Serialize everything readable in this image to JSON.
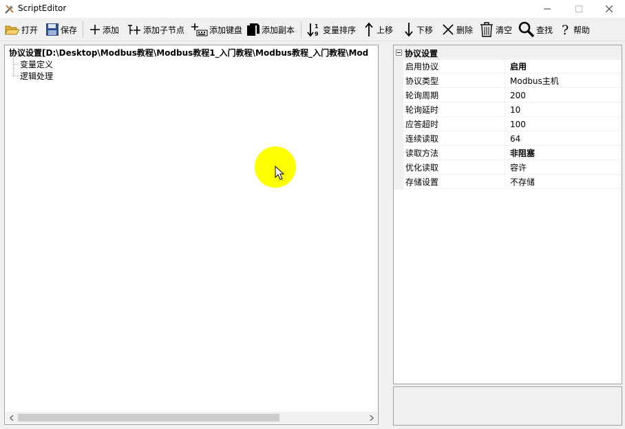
{
  "window": {
    "title": "ScriptEditor"
  },
  "toolbar": {
    "open": "打开",
    "save": "保存",
    "add": "添加",
    "add_child": "添加子节点",
    "add_keyboard": "添加键盘",
    "add_copy": "添加副本",
    "sort_vars": "变量排序",
    "move_up": "上移",
    "move_down": "下移",
    "delete": "删除",
    "clear": "清空",
    "find": "查找",
    "help": "帮助"
  },
  "tree": {
    "root": "协议设置[D:\\Desktop\\Modbus教程\\Modbus教程1_入门教程\\Modbus教程_入门教程\\Mod",
    "children": [
      "变量定义",
      "逻辑处理"
    ]
  },
  "properties": {
    "category": "协议设置",
    "rows": [
      {
        "name": "启用协议",
        "value": "启用"
      },
      {
        "name": "协议类型",
        "value": "Modbus主机"
      },
      {
        "name": "轮询周期",
        "value": "200"
      },
      {
        "name": "轮询延时",
        "value": "10"
      },
      {
        "name": "应答超时",
        "value": "100"
      },
      {
        "name": "连续读取",
        "value": "64"
      },
      {
        "name": "读取方法",
        "value": "非阻塞"
      },
      {
        "name": "优化读取",
        "value": "容许"
      },
      {
        "name": "存储设置",
        "value": "不存储"
      }
    ]
  },
  "colors": {
    "cursor_highlight": "#ffff00",
    "panel_border": "#a0a0a0",
    "window_bg": "#f0f0f0"
  }
}
